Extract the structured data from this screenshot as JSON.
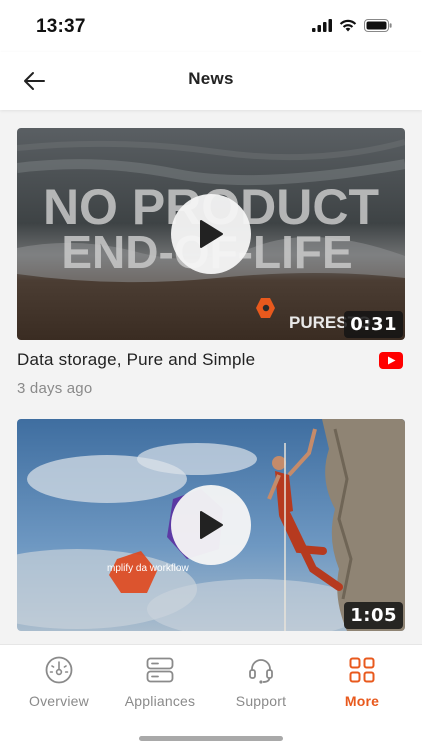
{
  "status": {
    "time": "13:37"
  },
  "header": {
    "title": "News"
  },
  "feed": {
    "items": [
      {
        "title": "Data storage, Pure and Simple",
        "date": "3 days ago",
        "duration": "0:31",
        "overlay_text_1": "NO PRODUCT",
        "overlay_text_2": "END-OF-LIFE",
        "brand_text": "PURESTO",
        "source_icon": "youtube-icon"
      },
      {
        "title": "",
        "date": "",
        "duration": "1:05",
        "overlay_text": "mplify da workflow",
        "source_icon": "youtube-icon"
      }
    ]
  },
  "tabs": [
    {
      "label": "Overview",
      "icon": "gauge-icon",
      "active": false
    },
    {
      "label": "Appliances",
      "icon": "server-icon",
      "active": false
    },
    {
      "label": "Support",
      "icon": "headset-icon",
      "active": false
    },
    {
      "label": "More",
      "icon": "grid-icon",
      "active": true
    }
  ],
  "colors": {
    "accent": "#e8591d",
    "youtube": "#ff0000"
  }
}
